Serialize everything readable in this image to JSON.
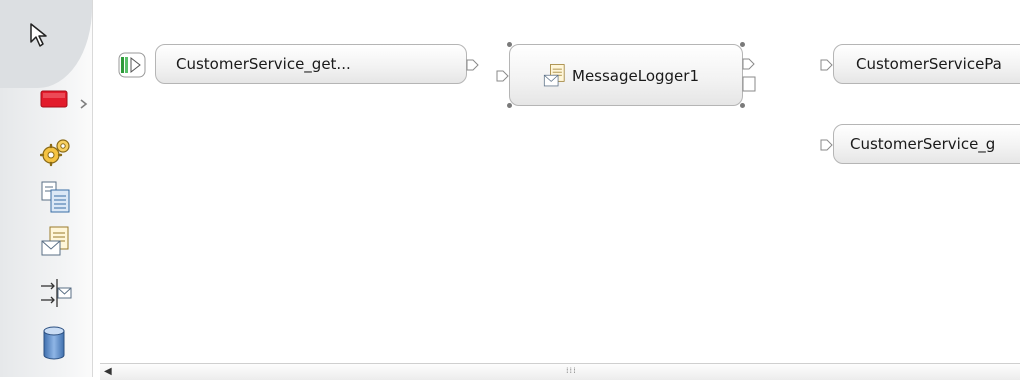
{
  "palette": {
    "tools": [
      {
        "name": "selection-arrow-icon"
      },
      {
        "name": "stop-node-icon"
      },
      {
        "name": "gears-icon"
      },
      {
        "name": "documents-icon"
      },
      {
        "name": "message-log-icon"
      },
      {
        "name": "route-message-icon"
      },
      {
        "name": "database-icon"
      }
    ],
    "colors": {
      "stop": "#e21b2b",
      "accent": "#3a6ea5"
    }
  },
  "canvas": {
    "nodes": [
      {
        "id": "customer-service-get",
        "label": "CustomerService_get..."
      },
      {
        "id": "message-logger",
        "label": "MessageLogger1"
      },
      {
        "id": "customer-service-pa",
        "label": "CustomerServicePa"
      },
      {
        "id": "customer-service-g",
        "label": "CustomerService_g"
      }
    ]
  },
  "scrollbar": {
    "left_arrow": "◀",
    "grip": "⁞⁞⁞"
  }
}
